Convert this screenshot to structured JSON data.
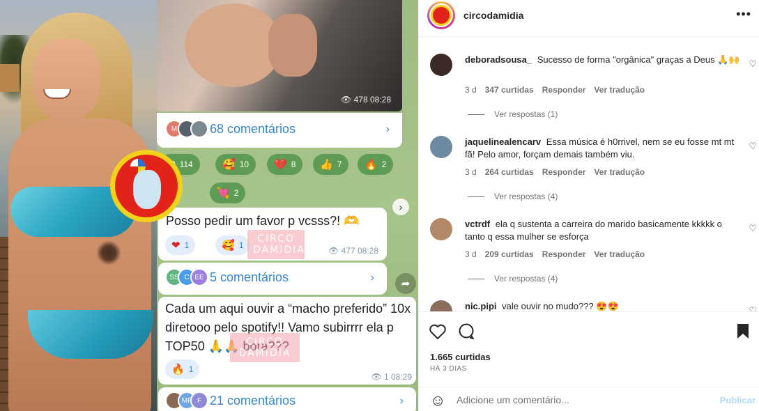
{
  "post": {
    "username": "circodamidia",
    "likes": "1.665 curtidas",
    "date": "HÁ 3 DIAS"
  },
  "media": {
    "chat": {
      "photo_meta": "👁 478 08:28",
      "comments_1": "68 comentários",
      "reactions": [
        {
          "emoji": "❤",
          "count": "114"
        },
        {
          "emoji": "🥰",
          "count": "10"
        },
        {
          "emoji": "💔",
          "count": "8"
        },
        {
          "emoji": "👍",
          "count": "7"
        },
        {
          "emoji": "🔥",
          "count": "2"
        },
        {
          "emoji": "💘",
          "count": "2"
        }
      ],
      "msg1_text": "Posso pedir um favor p vcsss?! 🫶",
      "msg1_reactions": [
        {
          "emoji": "❤",
          "count": "1"
        },
        {
          "emoji": "🥰",
          "count": "1"
        }
      ],
      "msg1_meta": "👁 477 08:28",
      "comments_2": "5 comentários",
      "msg2_text": "Cada um aqui ouvir a “macho preferido” 10x diretooo pelo spotify!! Vamo subirrrr ela p TOP50 🙏🙏 bora???",
      "msg2_reactions": [
        {
          "emoji": "🔥",
          "count": "1"
        }
      ],
      "msg2_meta": "👁 1 08:29",
      "comments_3": "21 comentários",
      "watermark": "CIRCO\nDAMIDIA",
      "avatars_1": [
        "M",
        "",
        ""
      ],
      "avatars_2": [
        "SS",
        "C",
        "EE"
      ],
      "avatars_3": [
        "",
        "MF",
        "F"
      ]
    }
  },
  "comments": [
    {
      "user": "deboradsousa_",
      "text": "Sucesso de forma \"orgânica\" graças a Deus 🙏🙌",
      "age": "3 d",
      "likes": "347 curtidas",
      "reply": "Responder",
      "translate": "Ver tradução",
      "replies": "Ver respostas (1)",
      "avatar_color": "#3b2a25"
    },
    {
      "user": "jaquelinealencarv",
      "text": "Essa música é h0rrivel, nem se eu fosse mt mt fã! Pelo amor, forçam demais também viu.",
      "age": "3 d",
      "likes": "264 curtidas",
      "reply": "Responder",
      "translate": "Ver tradução",
      "replies": "Ver respostas (4)",
      "avatar_color": "#6e8aa0"
    },
    {
      "user": "vctrdf",
      "text": "ela q sustenta a carreira do marido basicamente kkkkk o tanto q essa mulher se esforça",
      "age": "3 d",
      "likes": "209 curtidas",
      "reply": "Responder",
      "translate": "Ver tradução",
      "replies": "Ver respostas (4)",
      "avatar_color": "#b38866"
    },
    {
      "user": "nic.pipi",
      "text": "vale ouvir no mudo??? 😍😍",
      "avatar_color": "#8a6d5c"
    }
  ],
  "composer": {
    "placeholder": "Adicione um comentário...",
    "publish": "Publicar"
  },
  "icons": {
    "more": "more-options-icon",
    "like": "heart-icon",
    "comment": "comment-icon",
    "save": "bookmark-icon",
    "emoji": "emoji-icon"
  }
}
